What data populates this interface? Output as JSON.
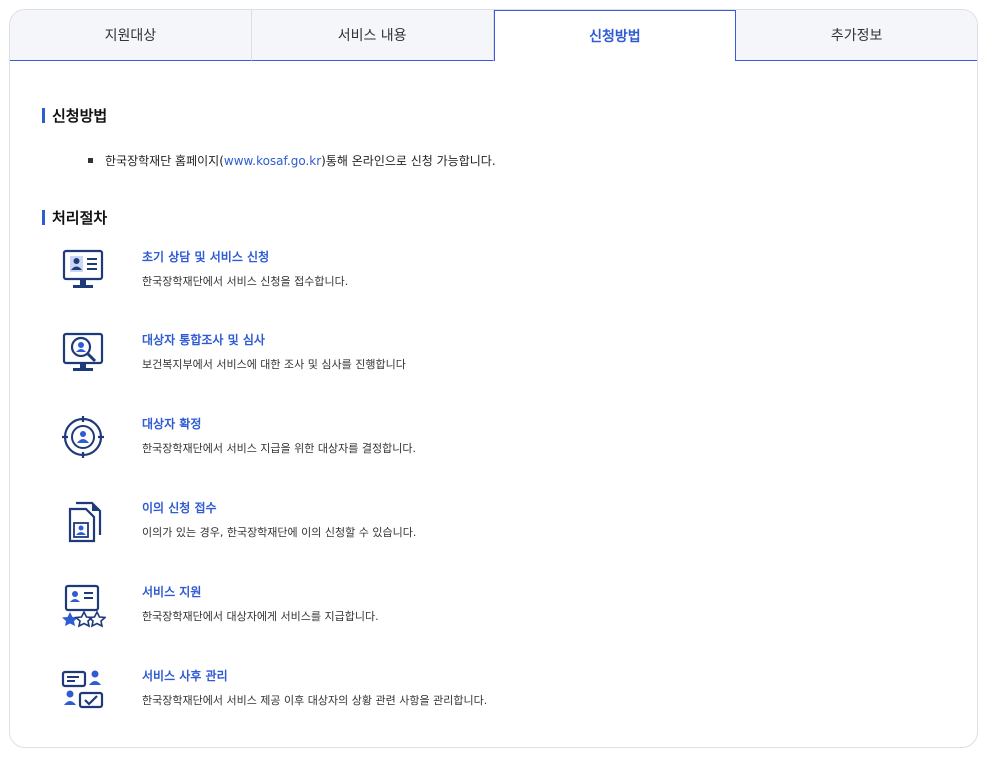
{
  "tabs": [
    {
      "label": "지원대상"
    },
    {
      "label": "서비스 내용"
    },
    {
      "label": "신청방법"
    },
    {
      "label": "추가정보"
    }
  ],
  "method": {
    "title": "신청방법",
    "text_before": "한국장학재단 홈페이지(",
    "link": "www.kosaf.go.kr",
    "text_after": ")통해 온라인으로 신청 가능합니다."
  },
  "process": {
    "title": "처리절차",
    "steps": [
      {
        "title": "초기 상담 및 서비스 신청",
        "desc": "한국장학재단에서 서비스 신청을 접수합니다.",
        "icon": "monitor-profile-icon"
      },
      {
        "title": "대상자 통합조사 및 심사",
        "desc": "보건복지부에서 서비스에 대한 조사 및 심사를 진행합니다",
        "icon": "monitor-search-user-icon"
      },
      {
        "title": "대상자 확정",
        "desc": "한국장학재단에서 서비스 지급을 위한 대상자를 결정합니다.",
        "icon": "target-user-icon"
      },
      {
        "title": "이의 신청 접수",
        "desc": "이의가 있는 경우, 한국장학재단에 이의 신청할 수 있습니다.",
        "icon": "document-user-icon"
      },
      {
        "title": "서비스 지원",
        "desc": "한국장학재단에서 대상자에게 서비스를 지급합니다.",
        "icon": "profile-stars-icon"
      },
      {
        "title": "서비스 사후 관리",
        "desc": "한국장학재단에서 서비스 제공 이후 대상자의 상황 관련 사항을 관리합니다.",
        "icon": "users-checklist-icon"
      }
    ]
  },
  "colors": {
    "accent": "#2f5bd3",
    "icon_dark": "#1f3a7a",
    "border": "#dcdfe5",
    "tab_bg": "#f4f6f9"
  }
}
